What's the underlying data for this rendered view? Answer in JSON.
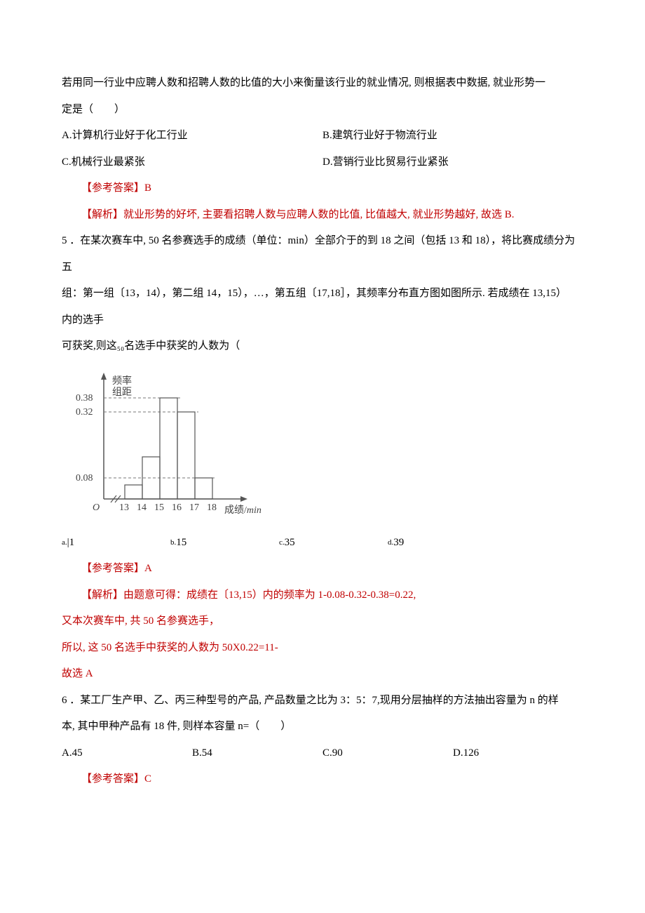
{
  "q4": {
    "stem_l1": "若用同一行业中应聘人数和招聘人数的比值的大小来衡量该行业的就业情况, 则根据表中数据, 就业形势一",
    "stem_l2": "定是（　　）",
    "optA": "A.计算机行业好于化工行业",
    "optB": "B.建筑行业好于物流行业",
    "optC": "C.机械行业最紧张",
    "optD": "D.营销行业比贸易行业紧张",
    "answer": "【参考答案】B",
    "explain": "【解析】就业形势的好坏, 主要看招聘人数与应聘人数的比值, 比值越大, 就业形势越好, 故选 B."
  },
  "q5": {
    "num": "5",
    "stem_l1": " ．在某次赛车中, 50 名参赛选手的成绩（单位：min）全部介于的到 18 之间（包括 13 和 18），将比赛成绩分为五",
    "stem_l2": "组：第一组〔13，14），第二组 14，15），…，第五组〔17,18］，其频率分布直方图如图所示. 若成绩在 13,15）",
    "stem_l3": "内的选手",
    "stem_l4": "可获奖,则这₅₀名选手中获奖的人数为（",
    "optA_lab": "a.",
    "optA_num": "|1",
    "optB_lab": "b.",
    "optB_num": "15",
    "optC_lab": "c.",
    "optC_num": "35",
    "optD_lab": "d.",
    "optD_num": "39",
    "answer": "【参考答案】A",
    "explain1": "【解析】由题意可得：成绩在〔13,15）内的频率为 1-0.08-0.32-0.38=0.22,",
    "explain2": "又本次赛车中, 共 50 名参赛选手，",
    "explain3": "所以, 这 50 名选手中获奖的人数为 50X0.22=11-",
    "explain4": "故选 A"
  },
  "q6": {
    "num": "6",
    "stem_l1": " ．某工厂生产甲、乙、丙三种型号的产品, 产品数量之比为 3：5：7,现用分层抽样的方法抽出容量为 n 的样",
    "stem_l2": "本, 其中甲种产品有 18 件, 则样本容量 n=（　　）",
    "optA": "A.45",
    "optB": "B.54",
    "optC": "C.90",
    "optD": "D.126",
    "answer": "【参考答案】C"
  },
  "chart_data": {
    "type": "bar",
    "title": "频率\n组距",
    "xlabel": "成绩/min",
    "ylabel": "",
    "x_ticks": [
      "13",
      "14",
      "15",
      "16",
      "17",
      "18"
    ],
    "y_ticks": [
      0.08,
      0.32,
      0.38
    ],
    "categories": [
      "13-14",
      "14-15",
      "15-16",
      "16-17",
      "17-18"
    ],
    "values": [
      null,
      null,
      0.38,
      0.32,
      0.08
    ],
    "notes": "Bars for 13-14 and 14-15 are shorter (heights not labeled on y-axis); 13-14 bar is the shortest, 14-15 bar is intermediate (together they sum to frequency 0.22)."
  }
}
